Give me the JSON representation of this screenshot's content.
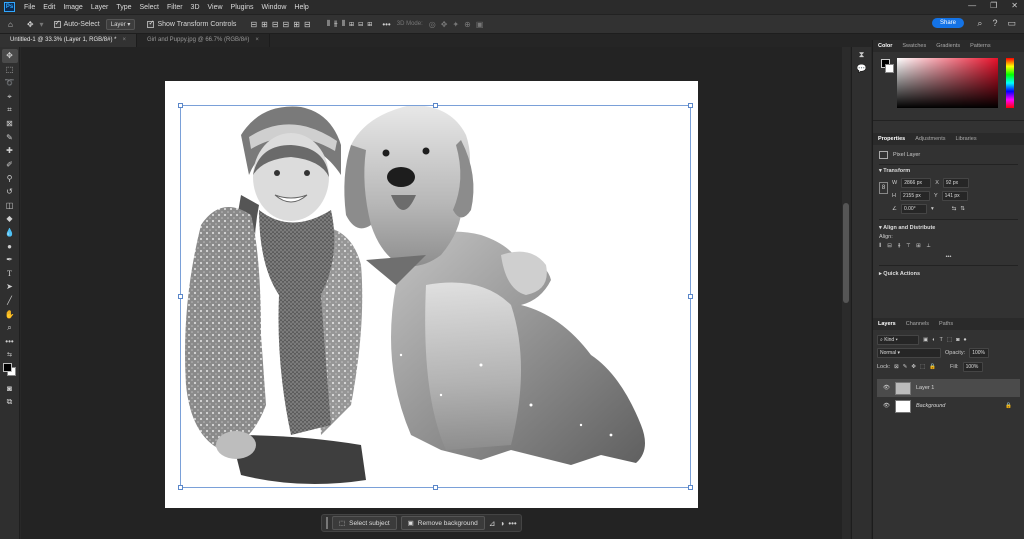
{
  "app": {
    "logo": "Ps"
  },
  "menu": [
    "File",
    "Edit",
    "Image",
    "Layer",
    "Type",
    "Select",
    "Filter",
    "3D",
    "View",
    "Plugins",
    "Window",
    "Help"
  ],
  "window_controls": {
    "minimize": "—",
    "restore": "❐",
    "close": "✕"
  },
  "options": {
    "auto_select_label": "Auto-Select",
    "layer_select": "Layer",
    "show_transform_label": "Show Transform Controls",
    "mode_3d": "3D Mode:",
    "share_label": "Share"
  },
  "tabs": [
    {
      "label": "Untitled-1 @ 33.3% (Layer 1, RGB/8#) *",
      "close": "×"
    },
    {
      "label": "Girl and Puppy.jpg @ 66.7% (RGB/8#)",
      "close": "×"
    }
  ],
  "contextual_bar": {
    "select_subject": "Select subject",
    "remove_background": "Remove background",
    "more": "•••"
  },
  "color_panel": {
    "tabs": [
      "Color",
      "Swatches",
      "Gradients",
      "Patterns"
    ]
  },
  "properties": {
    "tabs": [
      "Properties",
      "Adjustments",
      "Libraries"
    ],
    "pixel_layer": "Pixel Layer",
    "transform_title": "Transform",
    "w_label": "W",
    "w": "2866 px",
    "x_label": "X",
    "x": "92 px",
    "h_label": "H",
    "h": "2155 px",
    "y_label": "Y",
    "y": "141 px",
    "angle": "0.00°",
    "align_title": "Align and Distribute",
    "align_label": "Align:",
    "quick_actions": "Quick Actions",
    "more": "•••"
  },
  "layers_panel": {
    "tabs": [
      "Layers",
      "Channels",
      "Paths"
    ],
    "kind": "Kind",
    "blend_mode": "Normal",
    "opacity_label": "Opacity:",
    "opacity": "100%",
    "lock_label": "Lock:",
    "fill_label": "Fill:",
    "fill": "100%",
    "layers": [
      {
        "name": "Layer 1",
        "selected": true
      },
      {
        "name": "Background",
        "selected": false
      }
    ]
  }
}
